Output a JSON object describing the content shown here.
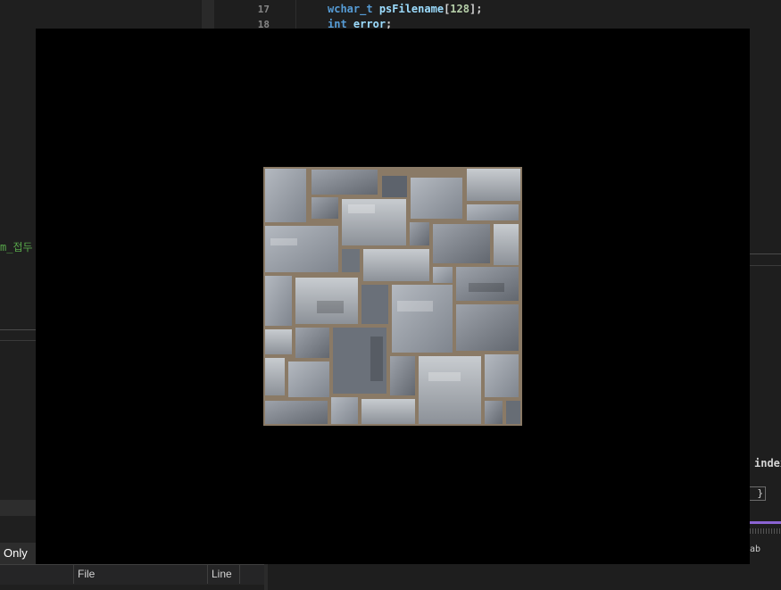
{
  "editor": {
    "lines": [
      {
        "number": "17",
        "code_type": "wchar_t",
        "code_name": "psFilename",
        "code_bracket_open": "[",
        "code_num": "128",
        "code_bracket_close": "];"
      },
      {
        "number": "18",
        "code_type": "int",
        "code_name": "error",
        "code_end": ";"
      }
    ]
  },
  "background": {
    "left_fragment": "m_접두",
    "right_fragment": "index",
    "brace": "}",
    "filter_label": "Only",
    "icons_text": "ab"
  },
  "error_list": {
    "columns": [
      "File",
      "Line"
    ]
  },
  "texture": {
    "description_icon": "stone-wall-texture",
    "mortar_color": "#8a7a66",
    "stone_color": "#9aa0a8"
  }
}
